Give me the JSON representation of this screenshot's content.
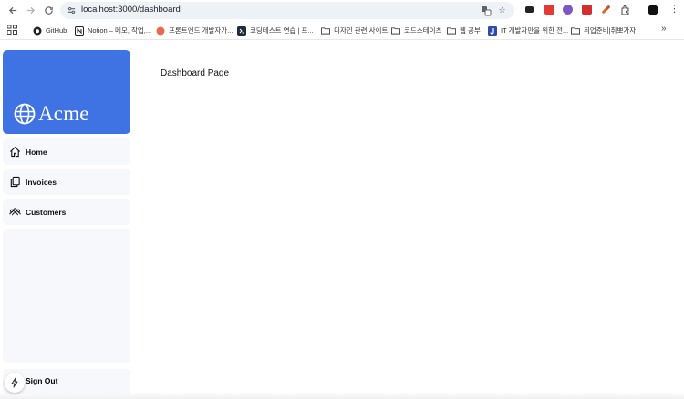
{
  "browser": {
    "url": "localhost:3000/dashboard",
    "bookmarks": [
      {
        "label": "GitHub",
        "icon": "github-icon"
      },
      {
        "label": "Notion – 메모, 작업,...",
        "icon": "notion-icon"
      },
      {
        "label": "프론트엔드 개발자가...",
        "icon": "circle-logo-icon"
      },
      {
        "label": "코딩테스트 연습 | 프...",
        "icon": "programmers-icon"
      },
      {
        "label": "디자인 관련 사이트",
        "icon": "folder-icon"
      },
      {
        "label": "코드스테이츠",
        "icon": "folder-icon"
      },
      {
        "label": "웹 공부",
        "icon": "folder-icon"
      },
      {
        "label": "IT 개발자만을 위한 전...",
        "icon": "j-logo-icon"
      },
      {
        "label": "취업준비|취뽀가자",
        "icon": "folder-icon"
      }
    ]
  },
  "app": {
    "brand": "Acme",
    "accent_color": "#3f72e3",
    "nav": [
      {
        "label": "Home",
        "icon": "home-icon"
      },
      {
        "label": "Invoices",
        "icon": "document-duplicate-icon"
      },
      {
        "label": "Customers",
        "icon": "user-group-icon"
      }
    ],
    "sign_out": "Sign Out"
  },
  "main": {
    "title": "Dashboard Page"
  }
}
